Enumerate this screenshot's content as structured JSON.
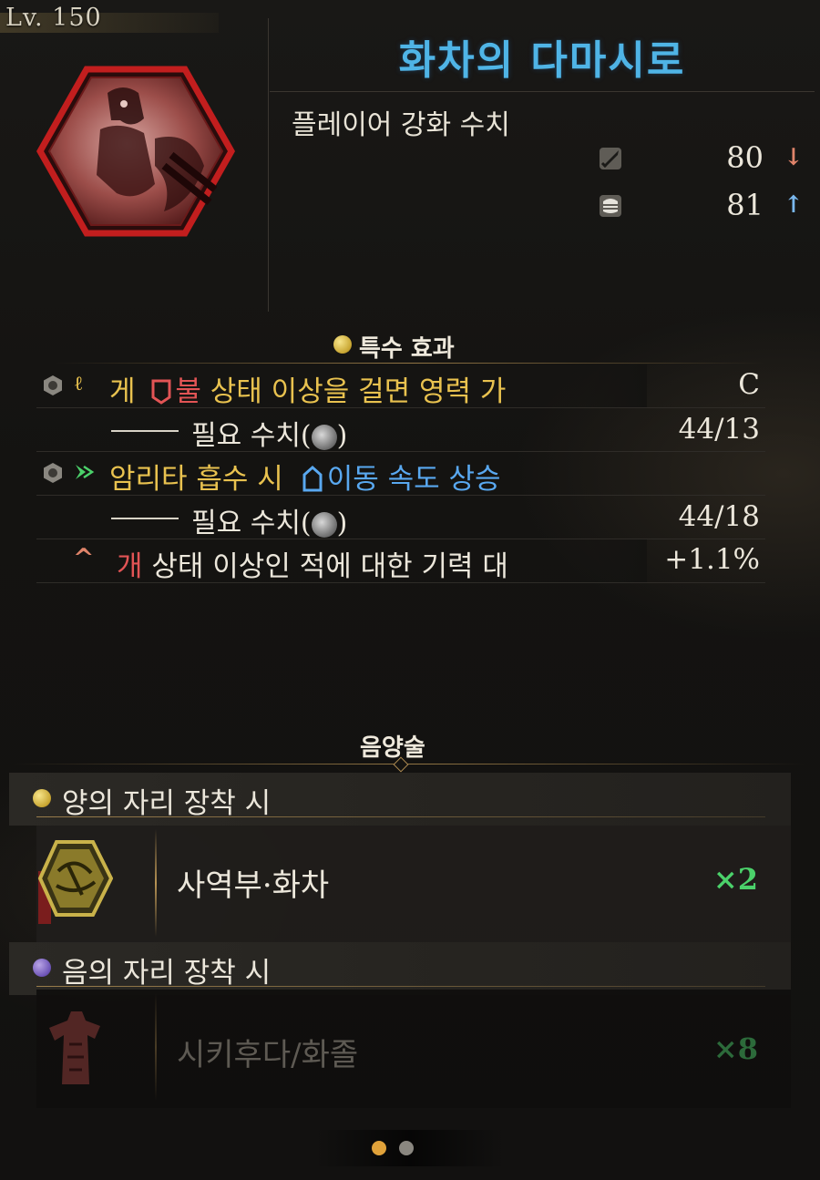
{
  "level": "Lv. 150",
  "item": {
    "title": "화차의 다마시로",
    "subtitle": "플레이어 강화 수치",
    "stats": [
      {
        "icon": "sword-icon",
        "value": "80",
        "trend": "down",
        "arrow": "↓"
      },
      {
        "icon": "armor-icon",
        "value": "81",
        "trend": "up",
        "arrow": "↑"
      }
    ]
  },
  "special": {
    "header": "특수 효과",
    "effects": [
      {
        "prefix": "게",
        "highlight": "불",
        "rest": " 상태 이상을 걸면 영력 가",
        "value": "C",
        "requirement_label": "필요 수치(",
        "requirement_close": ")",
        "requirement_value": "44/13"
      },
      {
        "prefix": "암리타 흡수 시",
        "highlight": "이동 속도 상승",
        "value": "",
        "requirement_label": "필요 수치(",
        "requirement_close": ")",
        "requirement_value": "44/18"
      }
    ],
    "bonus": {
      "highlight": "개",
      "rest": " 상태 이상인 적에 대한 기력 대",
      "value": "+1.1%"
    }
  },
  "onmyo": {
    "header": "음양술",
    "yang": {
      "label": "양의 자리 장착 시",
      "item_name": "사역부·화차",
      "count": "×2"
    },
    "yin": {
      "label": "음의 자리 장착 시",
      "item_name": "시키후다/화졸",
      "count": "×8"
    }
  },
  "colors": {
    "title": "#4fb4e6",
    "gold_text": "#e9c24f",
    "red_text": "#e25455",
    "blue_text": "#59a8f0",
    "count_green": "#4bd16a",
    "pager_active": "#e0a23a",
    "pager_inactive": "#8a8780"
  },
  "pager": {
    "pages": 2,
    "active": 1
  }
}
